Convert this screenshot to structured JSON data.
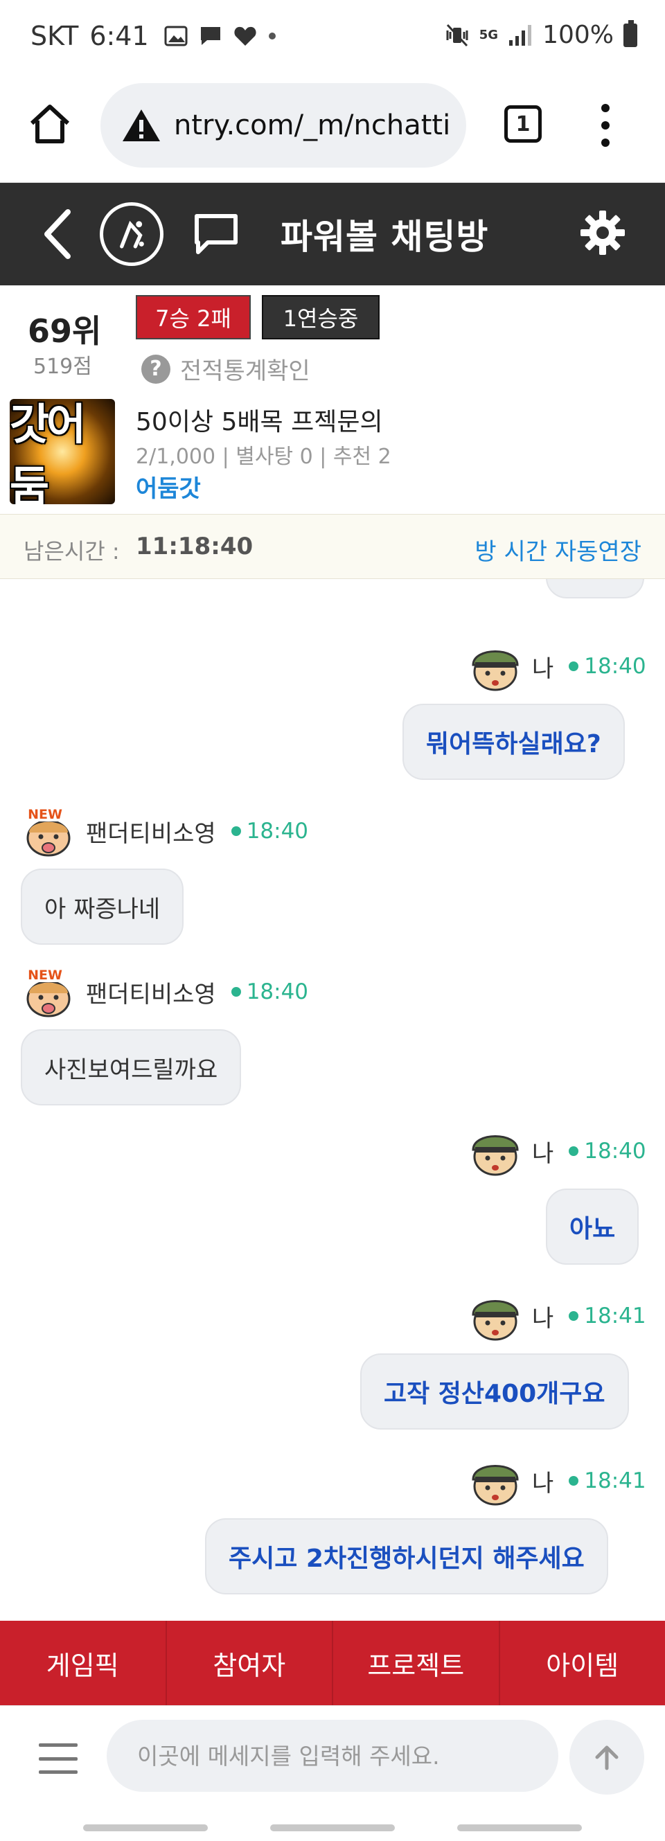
{
  "status_bar": {
    "carrier": "SKT",
    "time": "6:41",
    "battery": "100%",
    "network": "5G"
  },
  "browser": {
    "url": "ntry.com/_m/nchatti",
    "tab_count": "1",
    "icons": [
      "home-icon",
      "warning-icon",
      "tabs-icon",
      "more-vert-icon"
    ]
  },
  "header": {
    "title": "파워볼 채팅방",
    "icons": [
      "back-icon",
      "logo-icon",
      "chat-bubble-icon",
      "gear-icon"
    ]
  },
  "room": {
    "rank": "69위",
    "points": "519점",
    "record_badge": "7승 2패",
    "streak_badge": "1연승중",
    "stats_link": "전적통계확인",
    "thumbnail_text": "갓어둠",
    "name": "50이상 5배목 프젝문의",
    "meta": "2/1,000 | 별사탕 0 | 추천 2",
    "owner": "어둠갓"
  },
  "timer": {
    "label": "남은시간 :",
    "value": "11:18:40",
    "extend_label": "방 시간 자동연장"
  },
  "messages": [
    {
      "sender": "나",
      "time": "18:40",
      "text": "뭐어뜩하실래요?",
      "mine": true
    },
    {
      "sender": "팬더티비소영",
      "time": "18:40",
      "text": "아 짜증나네",
      "mine": false
    },
    {
      "sender": "팬더티비소영",
      "time": "18:40",
      "text": "사진보여드릴까요",
      "mine": false
    },
    {
      "sender": "나",
      "time": "18:40",
      "text": "아뇨",
      "mine": true
    },
    {
      "sender": "나",
      "time": "18:41",
      "text": "고작 정산400개구요",
      "mine": true
    },
    {
      "sender": "나",
      "time": "18:41",
      "text": "주시고 2차진행하시던지 해주세요",
      "mine": true
    }
  ],
  "tabs": [
    "게임픽",
    "참여자",
    "프로젝트",
    "아이템"
  ],
  "input": {
    "placeholder": "이곳에 메세지를 입력해 주세요."
  },
  "colors": {
    "header_bg": "#2f2f2f",
    "brand_red": "#c9202b",
    "link_blue": "#1d86d8",
    "time_green": "#2bb48f",
    "my_text_blue": "#1a4fbf"
  }
}
